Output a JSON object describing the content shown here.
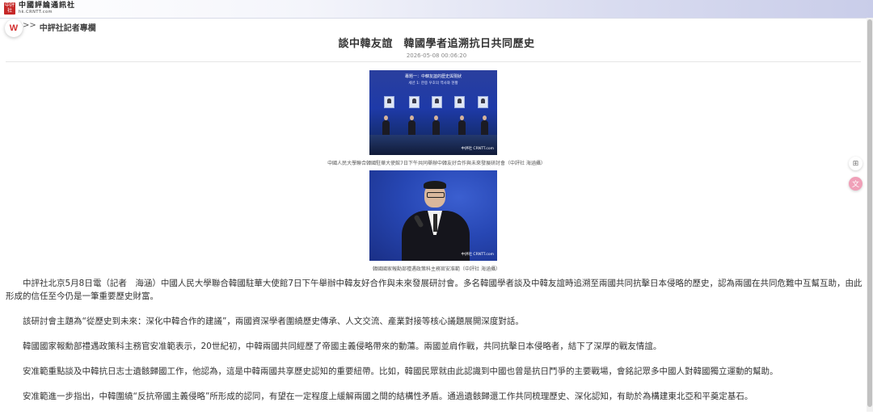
{
  "header": {
    "logo_seal": "中評社",
    "logo_name": "中國評論通訊社",
    "logo_sub": "hk.CRNTT.com"
  },
  "breadcrumb": {
    "home_glyph": "W",
    "separator": ">>",
    "section": "中評社記者專欄"
  },
  "article": {
    "title": "談中韓友誼　韓國學者追溯抗日共同歷史",
    "date": "2026-05-08 00:06:20",
    "photo1": {
      "banner_line1": "專題一：中韓友誼的歷史與現狀",
      "banner_line2": "세션 1: 한중 우호의 역사와 현황",
      "watermark": "中評社 CRNTT.com",
      "caption": "中國人民大學聯合韓國駐華大使館7日下午共同舉辦中韓友好合作與未來發展研討會（中評社 海涵攝）"
    },
    "photo2": {
      "watermark": "中評社 CRNTT.com",
      "caption": "韓國國家報勳部禮遇政策科主務官安准範（中評社 海涵攝）"
    },
    "paragraphs": [
      "中評社北京5月8日電（記者　海涵）中國人民大學聯合韓國駐華大使館7日下午舉辦中韓友好合作與未來發展研討會。多名韓國學者談及中韓友誼時追溯至兩國共同抗擊日本侵略的歷史，認為兩國在共同危難中互幫互助，由此形成的信任至今仍是一筆重要歷史財富。",
      "該研討會主題為“從歷史到未來：深化中韓合作的建議”，兩國資深學者圍繞歷史傳承、人文交流、產業對接等核心議題展開深度對話。",
      "韓國國家報勳部禮遇政策科主務官安准範表示，20世紀初，中韓兩國共同經歷了帝國主義侵略帶來的動蕩。兩國並肩作戰，共同抗擊日本侵略者，結下了深厚的戰友情誼。",
      "安准範重點談及中韓抗日志士遺骸歸國工作，他認為，這是中韓兩國共享歷史認知的重要紐帶。比如，韓國民眾就由此認識到中國也曾是抗日鬥爭的主要戰場，會銘記眾多中國人對韓國獨立運動的幫助。",
      "安准範進一步指出，中韓圍繞“反抗帝國主義侵略”所形成的認同，有望在一定程度上緩解兩國之間的結構性矛盾。通過遺骸歸還工作共同梳理歷史、深化認知，有助於為構建東北亞和平奠定基石。"
    ]
  },
  "side_buttons": {
    "qr_glyph": "⊞",
    "translate_glyph": "文"
  }
}
